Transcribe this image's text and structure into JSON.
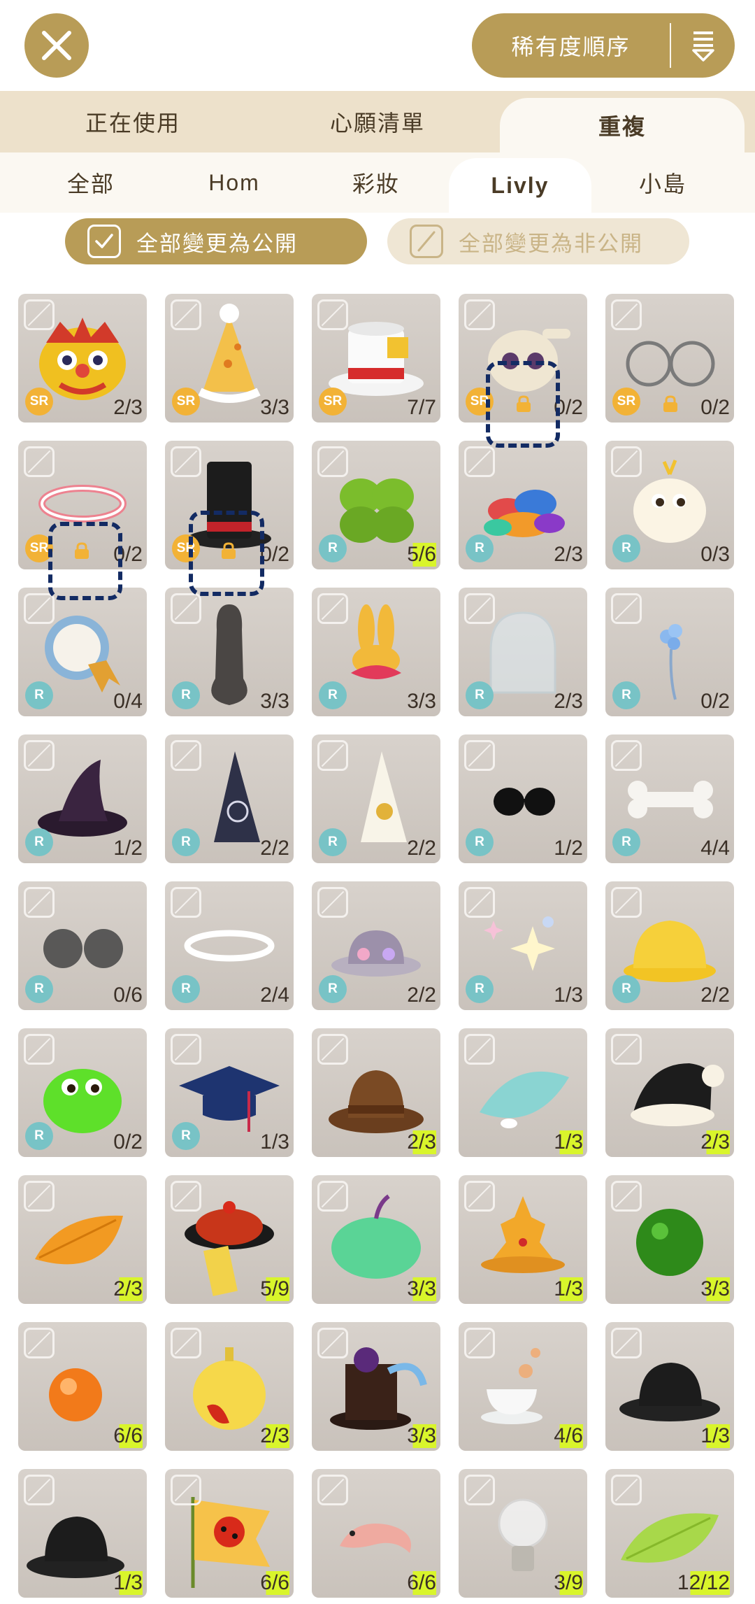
{
  "sort": {
    "label": "稀有度順序"
  },
  "tabs_primary": [
    "正在使用",
    "心願清單",
    "重複"
  ],
  "tabs_primary_active": 2,
  "tabs_secondary": [
    "全部",
    "Hom",
    "彩妝",
    "Livly",
    "小島"
  ],
  "tabs_secondary_active": 3,
  "bulk": {
    "public_label": "全部變更為公開",
    "private_label": "全部變更為非公開"
  },
  "colors": {
    "accent": "#b89c57",
    "rarity_sr": "#f2b236",
    "rarity_r": "#78c3c6",
    "count_highlight": "#d9f52b"
  },
  "items": [
    {
      "icon": "lion-mask",
      "rarity": "SR",
      "count": "2/3"
    },
    {
      "icon": "party-hat",
      "rarity": "SR",
      "count": "3/3"
    },
    {
      "icon": "top-hat-white",
      "rarity": "SR",
      "count": "7/7"
    },
    {
      "icon": "skull-hat",
      "rarity": "SR",
      "count": "0/2",
      "locked": true
    },
    {
      "icon": "round-glasses",
      "rarity": "SR",
      "count": "0/2",
      "locked": true
    },
    {
      "icon": "pink-halo",
      "rarity": "SR",
      "count": "0/2",
      "locked": true
    },
    {
      "icon": "black-top-hat",
      "rarity": "SR",
      "count": "0/2",
      "locked": true
    },
    {
      "icon": "clover",
      "rarity": "R",
      "count": "5/6",
      "hl": true
    },
    {
      "icon": "candy-pile",
      "rarity": "R",
      "count": "2/3"
    },
    {
      "icon": "fluffy-creature",
      "rarity": "R",
      "count": "0/3"
    },
    {
      "icon": "rosette-badge",
      "rarity": "R",
      "count": "0/4"
    },
    {
      "icon": "guitar-case",
      "rarity": "R",
      "count": "3/3"
    },
    {
      "icon": "bunny-ears-bow",
      "rarity": "R",
      "count": "3/3"
    },
    {
      "icon": "glass-dome",
      "rarity": "R",
      "count": "2/3"
    },
    {
      "icon": "blue-flower",
      "rarity": "R",
      "count": "0/2"
    },
    {
      "icon": "witch-hat",
      "rarity": "R",
      "count": "1/2"
    },
    {
      "icon": "wizard-hat-moon",
      "rarity": "R",
      "count": "2/2"
    },
    {
      "icon": "wizard-hat-sun",
      "rarity": "R",
      "count": "2/2"
    },
    {
      "icon": "sunglasses",
      "rarity": "R",
      "count": "1/2"
    },
    {
      "icon": "bone",
      "rarity": "R",
      "count": "4/4"
    },
    {
      "icon": "tinted-glasses",
      "rarity": "R",
      "count": "0/6"
    },
    {
      "icon": "white-halo",
      "rarity": "R",
      "count": "2/4"
    },
    {
      "icon": "ufo-hat",
      "rarity": "R",
      "count": "2/2"
    },
    {
      "icon": "sparkles",
      "rarity": "R",
      "count": "1/3"
    },
    {
      "icon": "yellow-helmet",
      "rarity": "R",
      "count": "2/2"
    },
    {
      "icon": "green-creature",
      "rarity": "R",
      "count": "0/2"
    },
    {
      "icon": "graduation-cap",
      "rarity": "R",
      "count": "1/3"
    },
    {
      "icon": "brown-hat",
      "rarity": "",
      "count": "2/3",
      "hl": true
    },
    {
      "icon": "teal-leaf",
      "rarity": "",
      "count": "1/3",
      "hl": true
    },
    {
      "icon": "santa-hat",
      "rarity": "",
      "count": "2/3",
      "hl": true
    },
    {
      "icon": "orange-leaf",
      "rarity": "",
      "count": "2/3",
      "hl": true
    },
    {
      "icon": "qing-hat",
      "rarity": "",
      "count": "5/9",
      "hl": true
    },
    {
      "icon": "green-pumpkin",
      "rarity": "",
      "count": "3/3",
      "hl": true
    },
    {
      "icon": "golden-crown",
      "rarity": "",
      "count": "1/3",
      "hl": true
    },
    {
      "icon": "moss-ball",
      "rarity": "",
      "count": "3/3",
      "hl": true
    },
    {
      "icon": "orange-orb",
      "rarity": "",
      "count": "6/6",
      "hl": true
    },
    {
      "icon": "apple-ornament",
      "rarity": "",
      "count": "2/3",
      "hl": true
    },
    {
      "icon": "rose-top-hat",
      "rarity": "",
      "count": "3/3",
      "hl": true
    },
    {
      "icon": "teacup",
      "rarity": "",
      "count": "4/6",
      "hl": true
    },
    {
      "icon": "black-bowler",
      "rarity": "",
      "count": "1/3",
      "hl": true
    },
    {
      "icon": "black-bowler-2",
      "rarity": "",
      "count": "1/3",
      "hl": true
    },
    {
      "icon": "ladybug-flag",
      "rarity": "",
      "count": "6/6",
      "hl": true
    },
    {
      "icon": "shrimp",
      "rarity": "",
      "count": "6/6",
      "hl": true
    },
    {
      "icon": "light-bulb",
      "rarity": "",
      "count": "3/9",
      "hl": true
    },
    {
      "icon": "green-leaf",
      "rarity": "",
      "count": "12/12",
      "hl": true
    }
  ]
}
